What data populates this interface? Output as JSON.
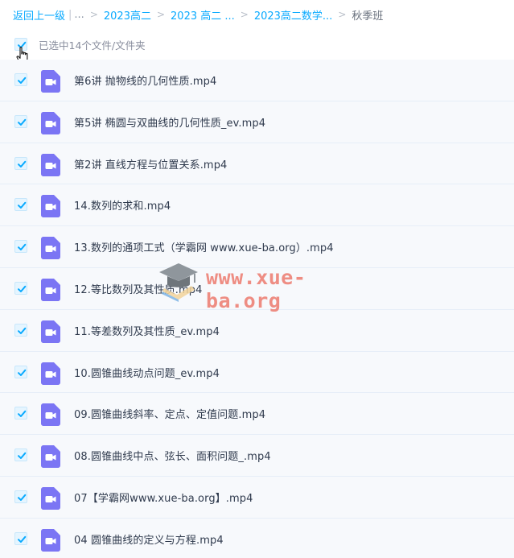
{
  "breadcrumb": {
    "back": "返回上一级",
    "pipe": "|",
    "ellipsis": "...",
    "items": [
      "2023高二",
      "2023 高二 ...",
      "2023高二数学..."
    ],
    "current": "秋季班",
    "separator": ">"
  },
  "selection": {
    "label": "已选中14个文件/文件夹"
  },
  "files": [
    "第6讲 抛物线的几何性质.mp4",
    "第5讲 椭圆与双曲线的几何性质_ev.mp4",
    "第2讲 直线方程与位置关系.mp4",
    "14.数列的求和.mp4",
    "13.数列的通项工式（学霸网 www.xue-ba.org）.mp4",
    "12.等比数列及其性质.mp4",
    "11.等差数列及其性质_ev.mp4",
    "10.圆锥曲线动点问题_ev.mp4",
    "09.圆锥曲线斜率、定点、定值问题.mp4",
    "08.圆锥曲线中点、弦长、面积问题_.mp4",
    "07【学霸网www.xue-ba.org】.mp4",
    "04 圆锥曲线的定义与方程.mp4"
  ],
  "watermark": {
    "text": "www.xue-ba.org",
    "icon": "graduation-cap-icon"
  },
  "icons": {
    "checkbox": "checkmark-icon",
    "file": "video-file-icon",
    "cursor": "hand-cursor-icon"
  },
  "colors": {
    "accent": "#09aaff",
    "file_icon": "#7b75f4",
    "row_bg": "#f7f9fc",
    "watermark": "#ec6e60"
  }
}
